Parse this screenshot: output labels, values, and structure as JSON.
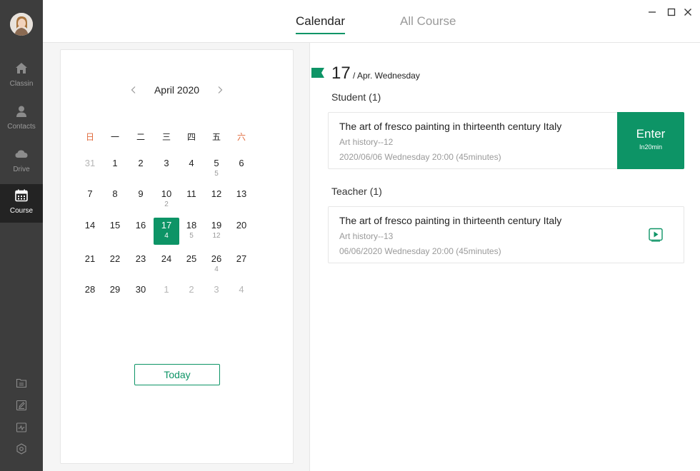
{
  "sidebar": {
    "items": [
      {
        "label": "Classin",
        "icon": "home-icon"
      },
      {
        "label": "Contacts",
        "icon": "person-icon"
      },
      {
        "label": "Drive",
        "icon": "cloud-icon"
      },
      {
        "label": "Course",
        "icon": "calendar-icon",
        "active": true
      }
    ],
    "tools": [
      "folder-icon",
      "edit-icon",
      "monitor-icon",
      "settings-icon"
    ]
  },
  "header": {
    "tabs": [
      {
        "label": "Calendar",
        "active": true
      },
      {
        "label": "All Course",
        "active": false
      }
    ]
  },
  "calendar": {
    "month_label": "April 2020",
    "weekdays": [
      "日",
      "一",
      "二",
      "三",
      "四",
      "五",
      "六"
    ],
    "weeks": [
      [
        {
          "d": "31",
          "c": "",
          "muted": true
        },
        {
          "d": "1",
          "c": ""
        },
        {
          "d": "2",
          "c": ""
        },
        {
          "d": "3",
          "c": ""
        },
        {
          "d": "4",
          "c": ""
        },
        {
          "d": "5",
          "c": "5"
        },
        {
          "d": "6",
          "c": ""
        }
      ],
      [
        {
          "d": "7",
          "c": ""
        },
        {
          "d": "8",
          "c": ""
        },
        {
          "d": "9",
          "c": ""
        },
        {
          "d": "10",
          "c": "2"
        },
        {
          "d": "11",
          "c": ""
        },
        {
          "d": "12",
          "c": ""
        },
        {
          "d": "13",
          "c": ""
        }
      ],
      [
        {
          "d": "14",
          "c": ""
        },
        {
          "d": "15",
          "c": ""
        },
        {
          "d": "16",
          "c": ""
        },
        {
          "d": "17",
          "c": "4",
          "selected": true
        },
        {
          "d": "18",
          "c": "5"
        },
        {
          "d": "19",
          "c": "12"
        },
        {
          "d": "20",
          "c": ""
        }
      ],
      [
        {
          "d": "21",
          "c": ""
        },
        {
          "d": "22",
          "c": ""
        },
        {
          "d": "23",
          "c": ""
        },
        {
          "d": "24",
          "c": ""
        },
        {
          "d": "25",
          "c": ""
        },
        {
          "d": "26",
          "c": "4"
        },
        {
          "d": "27",
          "c": ""
        }
      ],
      [
        {
          "d": "28",
          "c": ""
        },
        {
          "d": "29",
          "c": ""
        },
        {
          "d": "30",
          "c": ""
        },
        {
          "d": "1",
          "c": "",
          "muted": true
        },
        {
          "d": "2",
          "c": "",
          "muted": true
        },
        {
          "d": "3",
          "c": "",
          "muted": true
        },
        {
          "d": "4",
          "c": "",
          "muted": true
        }
      ]
    ],
    "today_label": "Today"
  },
  "detail": {
    "day": "17",
    "date_rest": "/ Apr. Wednesday",
    "student": {
      "heading": "Student (1)",
      "course_title": "The art of fresco painting in thirteenth century Italy",
      "course_sub": "Art history--12",
      "course_time": "2020/06/06 Wednesday 20:00 (45minutes)",
      "enter_label": "Enter",
      "enter_hint": "In20min"
    },
    "teacher": {
      "heading": "Teacher (1)",
      "course_title": "The art of fresco painting in thirteenth century Italy",
      "course_sub": "Art history--13",
      "course_time": "06/06/2020 Wednesday 20:00 (45minutes)"
    }
  },
  "colors": {
    "accent": "#0d9466",
    "sidebar_bg": "#3d3d3d",
    "weekend_red": "#e06a3b"
  }
}
